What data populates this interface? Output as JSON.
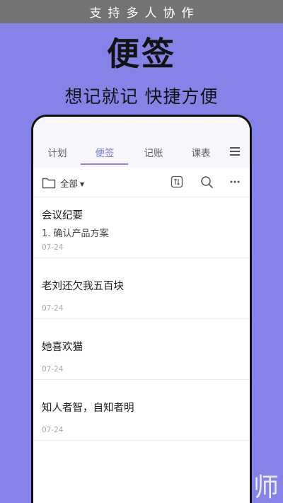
{
  "banner": {
    "text": "支持多人协作"
  },
  "hero": {
    "title": "便签",
    "subtitle": "想记就记 快捷方便"
  },
  "tabs": [
    {
      "label": "计划",
      "active": false
    },
    {
      "label": "便签",
      "active": true
    },
    {
      "label": "记账",
      "active": false
    },
    {
      "label": "课表",
      "active": false
    }
  ],
  "toolbar": {
    "folder_label": "全部",
    "caret": "▼"
  },
  "notes": [
    {
      "title": "会议纪要",
      "body": "1. 确认产品方案",
      "date": "07-24"
    },
    {
      "title": "老刘还欠我五百块",
      "body": "",
      "date": "07-24"
    },
    {
      "title": "她喜欢猫",
      "body": "",
      "date": "07-24"
    },
    {
      "title": "知人者智，自知者明",
      "body": "",
      "date": "07-24"
    }
  ],
  "watermark": {
    "text": "师"
  },
  "colors": {
    "background": "#8583e8",
    "accent": "#7a78e0",
    "banner": "#737373"
  }
}
